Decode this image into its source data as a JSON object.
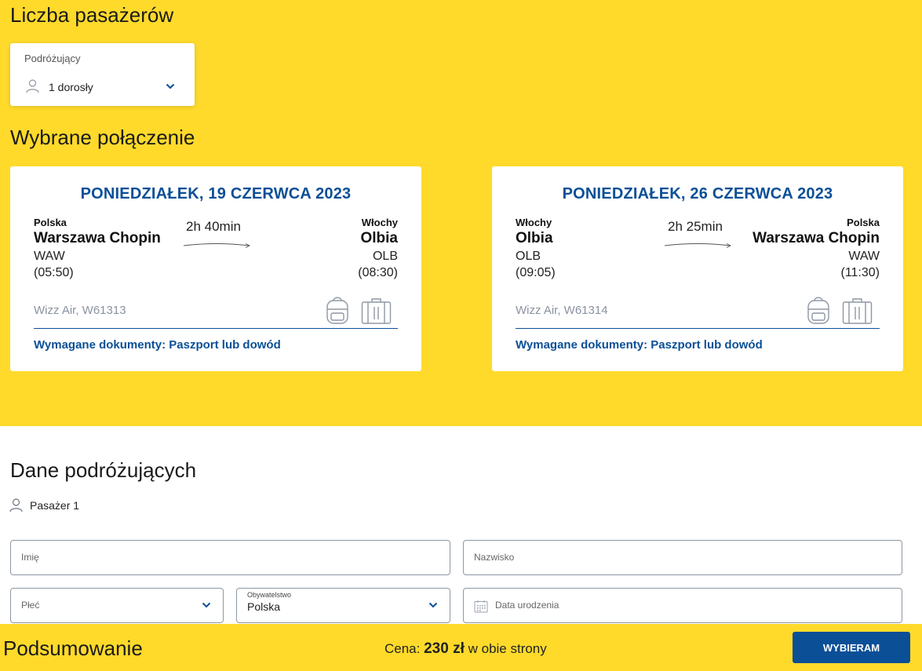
{
  "passengers": {
    "heading": "Liczba pasażerów",
    "select_label": "Podróżujący",
    "select_value": "1 dorosły"
  },
  "connection": {
    "heading": "Wybrane połączenie",
    "flights": [
      {
        "date": "PONIEDZIAŁEK, 19 CZERWCA 2023",
        "from": {
          "country": "Polska",
          "city": "Warszawa Chopin",
          "code": "WAW",
          "time": "(05:50)"
        },
        "to": {
          "country": "Włochy",
          "city": "Olbia",
          "code": "OLB",
          "time": "(08:30)"
        },
        "duration": "2h 40min",
        "carrier": "Wizz Air, W61313",
        "documents": "Wymagane dokumenty: Paszport lub dowód"
      },
      {
        "date": "PONIEDZIAŁEK, 26 CZERWCA 2023",
        "from": {
          "country": "Włochy",
          "city": "Olbia",
          "code": "OLB",
          "time": "(09:05)"
        },
        "to": {
          "country": "Polska",
          "city": "Warszawa Chopin",
          "code": "WAW",
          "time": "(11:30)"
        },
        "duration": "2h 25min",
        "carrier": "Wizz Air, W61314",
        "documents": "Wymagane dokumenty: Paszport lub dowód"
      }
    ]
  },
  "travelers": {
    "heading": "Dane podróżujących",
    "passenger_label": "Pasażer 1",
    "fields": {
      "first_name_placeholder": "Imię",
      "last_name_placeholder": "Nazwisko",
      "gender_placeholder": "Płeć",
      "citizenship_label": "Obywatelstwo",
      "citizenship_value": "Polska",
      "birthdate_placeholder": "Data urodzenia"
    }
  },
  "summary": {
    "title": "Podsumowanie",
    "price_prefix": "Cena:",
    "price_value": "230 zł",
    "price_suffix": "w obie strony",
    "button_label": "WYBIERAM"
  },
  "colors": {
    "brand_yellow": "#FFDA2B",
    "brand_blue": "#0b4f97"
  },
  "icons": {
    "user": "person-outline-icon",
    "chevron": "chevron-down-icon",
    "backpack": "backpack-icon",
    "suitcase": "suitcase-icon",
    "calendar": "calendar-icon"
  }
}
